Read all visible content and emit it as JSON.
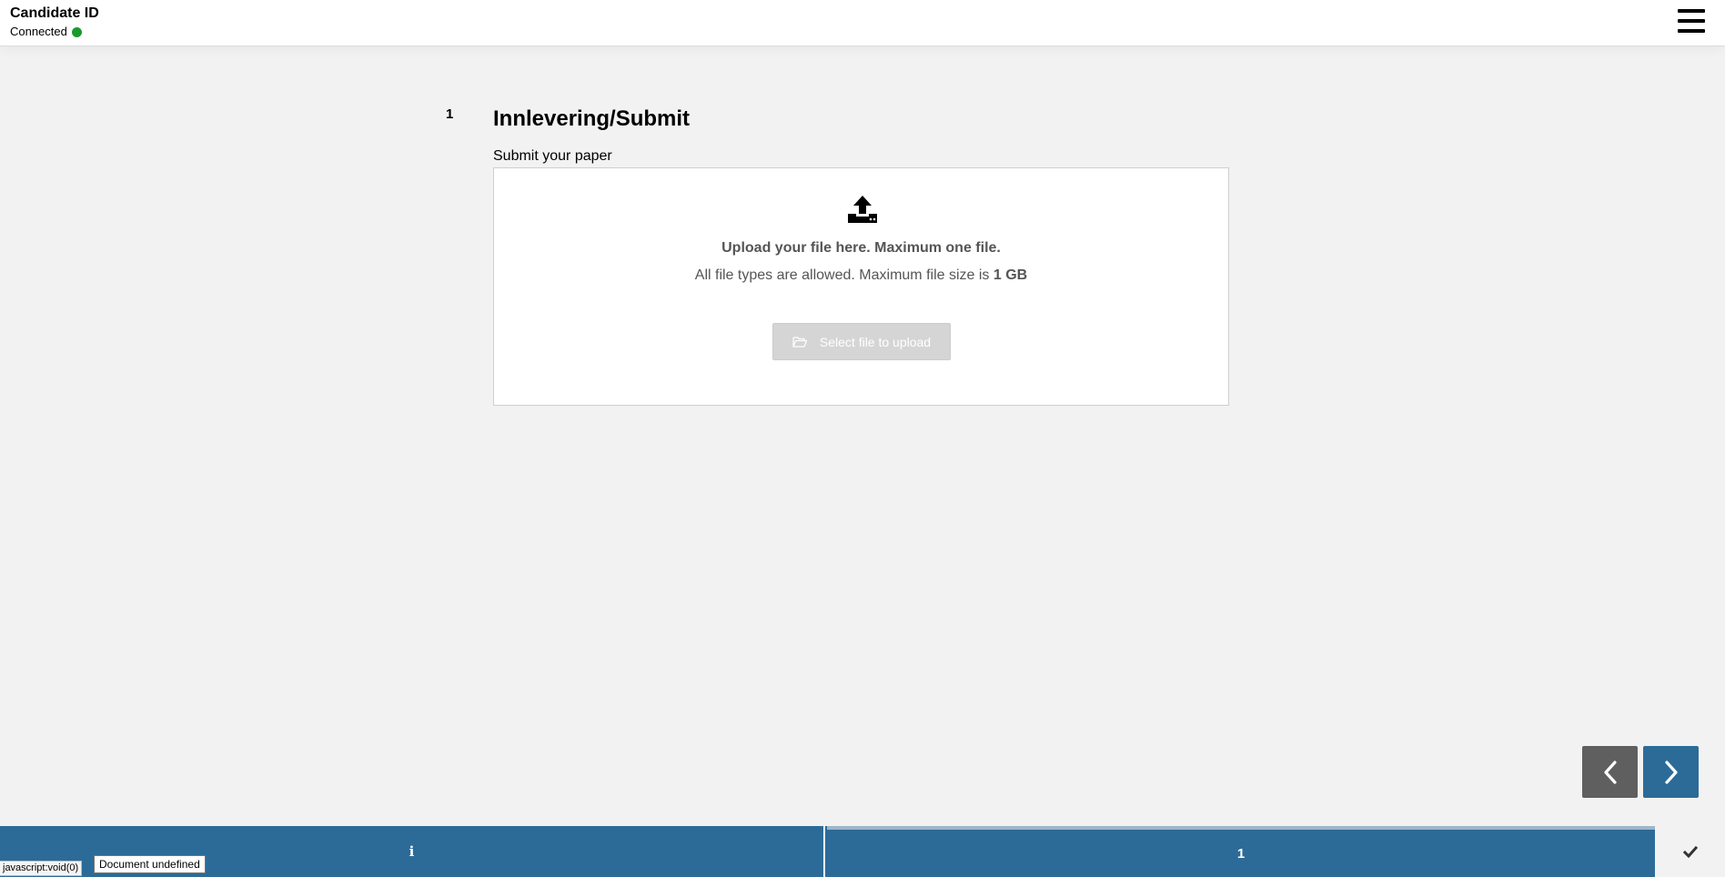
{
  "header": {
    "title": "Candidate ID",
    "status": "Connected",
    "status_color": "#1a9a2b",
    "menu_icon": "hamburger-menu-icon"
  },
  "question": {
    "number": "1",
    "title": "Innlevering/Submit",
    "subtitle": "Submit your paper"
  },
  "upload": {
    "icon": "upload-icon",
    "heading": "Upload your file here. Maximum one file.",
    "info_prefix": "All file types are allowed. Maximum file size is ",
    "info_size": "1 GB",
    "button_label": "Select file to upload",
    "button_icon": "folder-open-icon"
  },
  "navigation": {
    "prev_icon": "chevron-left-icon",
    "next_icon": "chevron-right-icon"
  },
  "footer": {
    "info_label": "i",
    "page_label": "1",
    "submit_icon": "checkmark-icon"
  },
  "browser": {
    "status_link": "javascript:void(0)",
    "tooltip": "Document undefined"
  },
  "colors": {
    "accent": "#2c6b98",
    "prev_button": "#5f5f5f",
    "background": "#f2f2f2"
  }
}
